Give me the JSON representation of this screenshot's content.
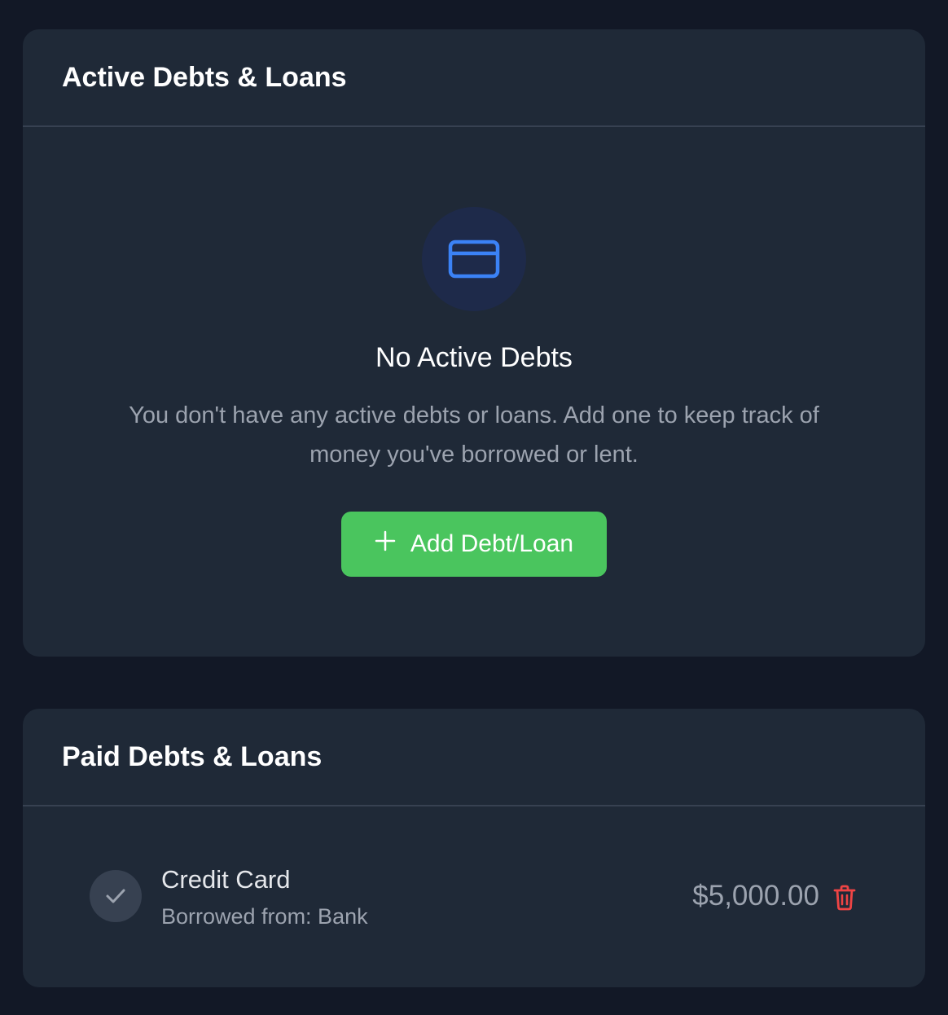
{
  "active_section": {
    "title": "Active Debts & Loans",
    "empty_title": "No Active Debts",
    "empty_description": "You don't have any active debts or loans. Add one to keep track of money you've borrowed or lent.",
    "add_button_label": "Add Debt/Loan",
    "empty_icon": "credit-card-icon"
  },
  "paid_section": {
    "title": "Paid Debts & Loans",
    "items": [
      {
        "name": "Credit Card",
        "subtitle": "Borrowed from: Bank",
        "amount": "$5,000.00",
        "status_icon": "check-icon",
        "action_icon": "trash-icon"
      }
    ]
  },
  "colors": {
    "background": "#121826",
    "card": "#1f2937",
    "accent_blue": "#3b82f6",
    "success_green": "#4ac55e",
    "danger_red": "#ef4444"
  }
}
